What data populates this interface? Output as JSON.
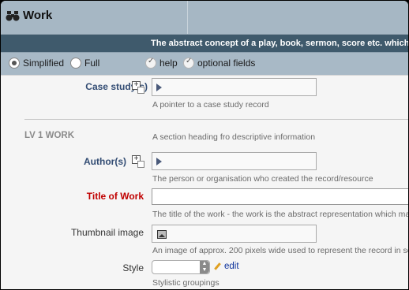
{
  "header": {
    "title": "Work",
    "icon": "binoculars-icon"
  },
  "description_bar": {
    "text": "The abstract concept of a play, book, sermon, score etc. which can"
  },
  "options": {
    "simplified_label": "Simplified",
    "full_label": "Full",
    "help_label": "help",
    "optional_fields_label": "optional fields",
    "mode_selected": "Simplified"
  },
  "fields": {
    "case_study": {
      "label": "Case study(s)",
      "help": "A pointer to a case study record"
    },
    "section": {
      "heading": "LV 1 WORK",
      "help": "A section heading fro descriptive information"
    },
    "authors": {
      "label": "Author(s)",
      "help": "The person or organisation who created the record/resource"
    },
    "title_of_work": {
      "label": "Title of Work",
      "value": "",
      "help": "The title of the work - the work is the abstract representation which may b"
    },
    "thumbnail": {
      "label": "Thumbnail image",
      "help": "An image of approx. 200 pixels wide used to represent the record in searc"
    },
    "style": {
      "label": "Style",
      "selected": "",
      "edit_label": "edit",
      "help": "Stylistic groupings"
    }
  }
}
